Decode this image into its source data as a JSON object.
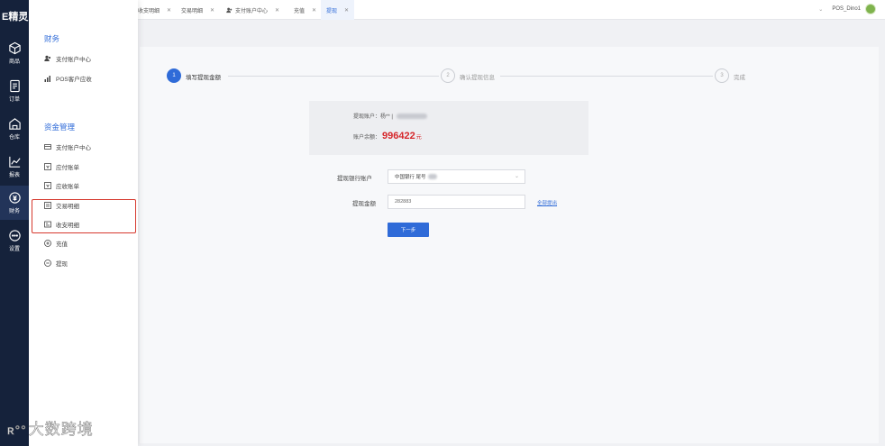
{
  "app": {
    "logo": "E精灵"
  },
  "rail": [
    {
      "label": "商品",
      "icon": "cube-icon"
    },
    {
      "label": "订单",
      "icon": "document-icon"
    },
    {
      "label": "仓库",
      "icon": "warehouse-icon"
    },
    {
      "label": "报表",
      "icon": "chart-icon"
    },
    {
      "label": "财务",
      "icon": "finance-icon"
    },
    {
      "label": "设置",
      "icon": "settings-icon"
    }
  ],
  "menu": {
    "group1_title": "财务",
    "group1_items": [
      "支付账户中心",
      "POS客户应收"
    ],
    "group2_title": "资金管理",
    "group2_items": [
      "支付账户中心",
      "应付账单",
      "应收账单",
      "交易明细",
      "收支明细",
      "充值",
      "提现"
    ]
  },
  "watermark": "大数跨境",
  "tabs": [
    {
      "label": "收支明细"
    },
    {
      "label": "交易明细"
    },
    {
      "label": "支付账户中心"
    },
    {
      "label": "充值"
    },
    {
      "label": "提现"
    }
  ],
  "user": {
    "name": "POS_Dino1"
  },
  "steps": [
    {
      "num": "1",
      "label": "填写提现金额"
    },
    {
      "num": "2",
      "label": "确认提现信息"
    },
    {
      "num": "3",
      "label": "完成"
    }
  ],
  "info": {
    "account_label": "提现账户：",
    "account_value": "杨** |",
    "balance_label": "账户余额：",
    "balance_value": "996422",
    "balance_unit": "元"
  },
  "form": {
    "bank_label": "提现银行账户",
    "bank_value": "中国银行 尾号",
    "amount_label": "提现金额",
    "amount_value": "282883",
    "withdraw_all": "全部提出",
    "next": "下一步"
  },
  "colors": {
    "accent": "#2f6bd8",
    "rail": "#15223b",
    "amount": "#d6272b",
    "highlight": "#d6392e"
  }
}
